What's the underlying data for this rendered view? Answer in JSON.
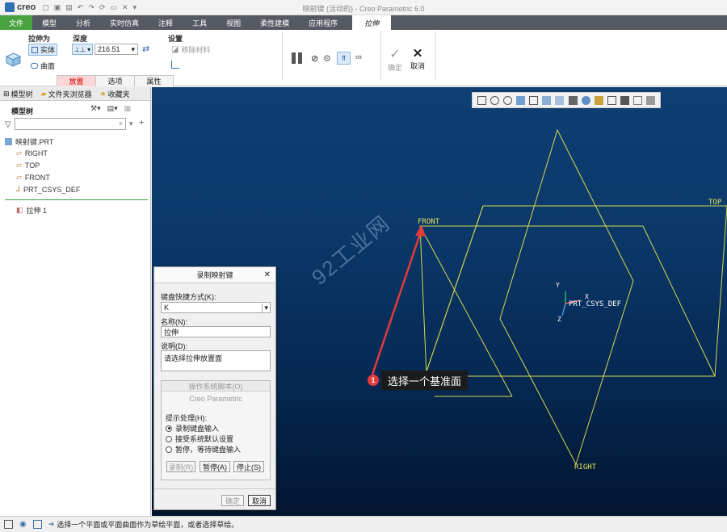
{
  "app": {
    "logo": "creo",
    "window_title": "映射键 (活动的) - Creo Parametric 6.0"
  },
  "tabs": [
    "文件",
    "模型",
    "分析",
    "实时仿真",
    "注释",
    "工具",
    "视图",
    "柔性建模",
    "应用程序"
  ],
  "active_tab": "拉伸",
  "ribbon": {
    "extrude_as": "拉伸为",
    "solid": "实体",
    "surface": "曲面",
    "depth": "深度",
    "depth_value": "216.51",
    "settings": "设置",
    "remove_material": "移除材料",
    "ok": "确定",
    "cancel": "取消"
  },
  "subtabs": [
    "放置",
    "选项",
    "属性"
  ],
  "left_panel": {
    "nav_tabs": [
      "模型树",
      "文件夹浏览器",
      "收藏夹"
    ],
    "tree_title": "模型树",
    "items": [
      "映射键.PRT",
      "RIGHT",
      "TOP",
      "FRONT",
      "PRT_CSYS_DEF",
      "拉伸 1"
    ]
  },
  "viewport": {
    "labels": {
      "front": "FRONT",
      "top": "TOP",
      "right": "RIGHT",
      "csys": "PRT_CSYS_DEF",
      "x": "X",
      "y": "Y",
      "z": "Z"
    },
    "watermark": "92工业网"
  },
  "callout": {
    "number": "1",
    "text": "选择一个基准面"
  },
  "dialog": {
    "title": "录制映射键",
    "shortcut_label": "键盘快捷方式(K):",
    "shortcut_value": "K",
    "name_label": "名称(N):",
    "name_value": "拉伸",
    "desc_label": "说明(D):",
    "desc_value": "请选择拉伸放置面",
    "os_script": "操作系统脚本(O)",
    "creo": "Creo Parametric",
    "prompt_label": "提示处理(H):",
    "radios": [
      "录制键盘输入",
      "接受系统默认设置",
      "暂停，等待键盘输入"
    ],
    "record": "录制(R)",
    "pause": "暂停(A)",
    "stop": "停止(S)",
    "ok": "确定",
    "cancel": "取消"
  },
  "status": {
    "message": "选择一个平面或平面曲面作为草绘平面，或者选择草绘。"
  }
}
